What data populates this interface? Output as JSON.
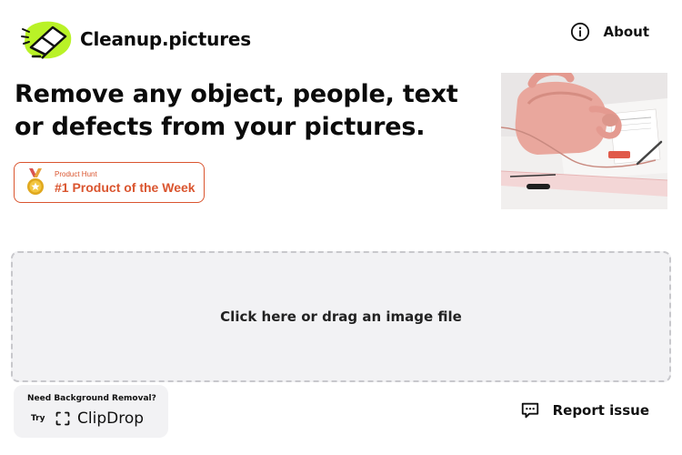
{
  "app": {
    "name": "Cleanup.pictures"
  },
  "header": {
    "about_label": "About"
  },
  "hero": {
    "headline": "Remove any object, people, text or defects from your pictures.",
    "product_hunt": {
      "small_label": "Product Hunt",
      "badge_label": "#1 Product of the Week"
    }
  },
  "upload": {
    "prompt": "Click here or drag an image file"
  },
  "promo": {
    "title": "Need Background Removal?",
    "try_label": "Try",
    "product_name": "ClipDrop"
  },
  "footer": {
    "report_label": "Report issue"
  },
  "colors": {
    "accent_green": "#b9f227",
    "product_hunt_orange": "#da552f",
    "dropzone_bg": "#f2f2f4",
    "text": "#0b0b0b"
  },
  "icons": {
    "logo": "eraser-icon",
    "about": "info-circle-icon",
    "medal": "medal-icon",
    "clipdrop": "clipdrop-icon",
    "report": "chat-bubble-icon"
  }
}
